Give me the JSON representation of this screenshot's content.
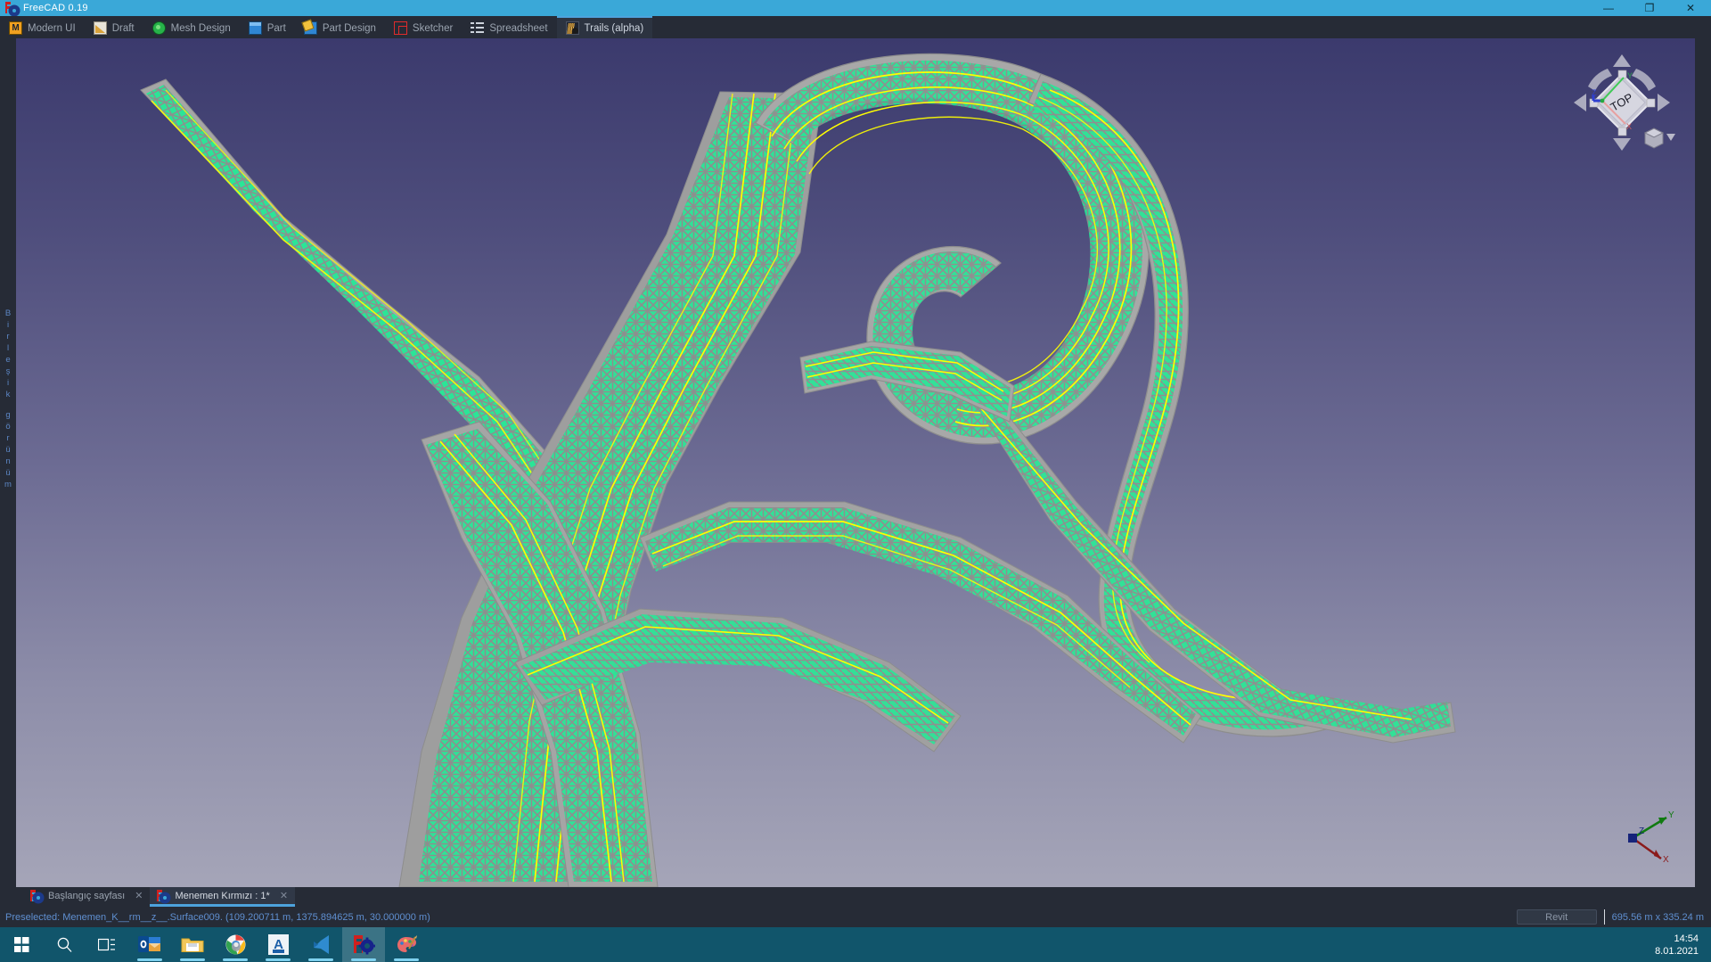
{
  "window": {
    "title": "FreeCAD 0.19",
    "app_icon": "freecad-icon",
    "controls": [
      {
        "name": "minimize",
        "glyph": "—"
      },
      {
        "name": "restore",
        "glyph": "❐"
      },
      {
        "name": "close",
        "glyph": "✕"
      }
    ]
  },
  "workbench_tabs": [
    {
      "label": "Modern UI",
      "icon": "modern-ui-icon",
      "icon_class": "ico-modernui",
      "active": false
    },
    {
      "label": "Draft",
      "icon": "draft-icon",
      "icon_class": "ico-draft",
      "active": false
    },
    {
      "label": "Mesh Design",
      "icon": "mesh-design-icon",
      "icon_class": "ico-mesh",
      "active": false
    },
    {
      "label": "Part",
      "icon": "part-icon",
      "icon_class": "ico-part",
      "active": false
    },
    {
      "label": "Part Design",
      "icon": "part-design-icon",
      "icon_class": "ico-partdesign",
      "active": false
    },
    {
      "label": "Sketcher",
      "icon": "sketcher-icon",
      "icon_class": "ico-sketcher",
      "active": false
    },
    {
      "label": "Spreadsheet",
      "icon": "spreadsheet-icon",
      "icon_class": "ico-spreadsheet",
      "active": false
    },
    {
      "label": "Trails (alpha)",
      "icon": "trails-icon",
      "icon_class": "ico-trails",
      "active": true
    }
  ],
  "sidebar": {
    "vertical_label": "Birleşik görünüm",
    "letters_top": [
      "B",
      "i",
      "r",
      "l",
      "e",
      "ş",
      "i",
      "k"
    ],
    "letters_bottom": [
      "g",
      "ö",
      "r",
      "ü",
      "n",
      "ü",
      "m"
    ]
  },
  "viewport": {
    "nav_cube_label": "TOP",
    "nav_cube_axes": {
      "x": "X",
      "y": "Y",
      "z": "Z"
    },
    "axis_cross": {
      "x": "X",
      "y": "Y",
      "z": "Z"
    },
    "background_top": "#3b3a6d",
    "background_bottom": "#a5a5b8",
    "model": {
      "name": "Menemen_K__rm__z__.Surface009",
      "face_color": "#25e896",
      "edge_color": "#8e8e8e",
      "section_line_color": "#ffff00",
      "description": "Highway corridor / road alignment triangulated surfaces, top view"
    }
  },
  "document_tabs": [
    {
      "label": "Başlangıç sayfası",
      "icon": "freecad-icon",
      "close": "✕",
      "active": false
    },
    {
      "label": "Menemen Kırmızı : 1*",
      "icon": "freecad-icon",
      "close": "✕",
      "active": true
    }
  ],
  "statusbar": {
    "message": "Preselected: Menemen_K__rm__z__.Surface009. (109.200711 m, 1375.894625 m, 30.000000 m)",
    "revit_button": "Revit",
    "dimensions": "695.56 m x 335.24 m"
  },
  "taskbar": {
    "items": [
      {
        "name": "start-button",
        "icon": "windows-logo-icon",
        "running": false,
        "active": false
      },
      {
        "name": "search-button",
        "icon": "search-icon",
        "running": false,
        "active": false
      },
      {
        "name": "task-view-button",
        "icon": "task-view-icon",
        "running": false,
        "active": false
      },
      {
        "name": "outlook",
        "icon": "outlook-icon",
        "running": true,
        "active": false
      },
      {
        "name": "file-explorer",
        "icon": "file-explorer-icon",
        "running": true,
        "active": false
      },
      {
        "name": "chrome",
        "icon": "chrome-icon",
        "running": true,
        "active": false
      },
      {
        "name": "autocad",
        "icon": "autocad-icon",
        "running": true,
        "active": false
      },
      {
        "name": "vscode",
        "icon": "vscode-icon",
        "running": true,
        "active": false
      },
      {
        "name": "freecad",
        "icon": "freecad-icon",
        "running": true,
        "active": true
      },
      {
        "name": "paint",
        "icon": "paint-icon",
        "running": true,
        "active": false
      }
    ],
    "clock_time": "14:54",
    "clock_date": "8.01.2021"
  }
}
